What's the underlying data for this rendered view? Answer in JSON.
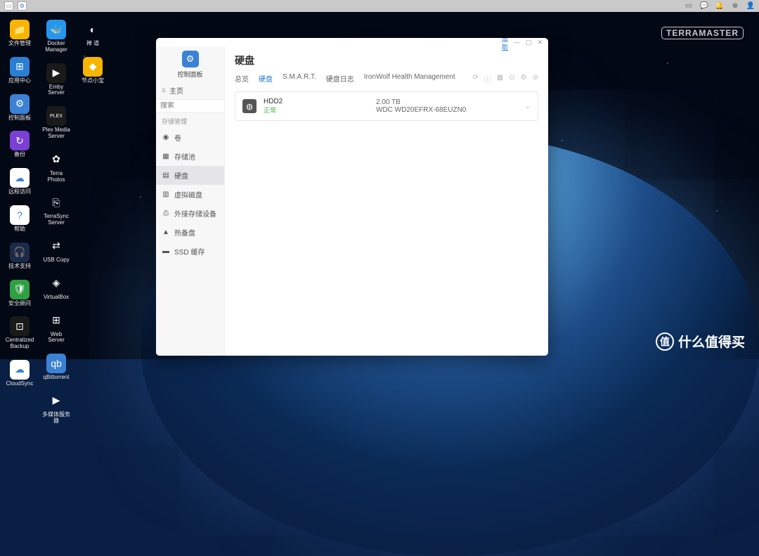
{
  "brand": "TERRAMASTER",
  "watermark": {
    "icon": "值",
    "text": "什么值得买"
  },
  "taskbar": {
    "left_apps": [
      "desktop",
      "control-panel"
    ],
    "right_icons": [
      "screen",
      "chat",
      "bell",
      "globe",
      "user"
    ]
  },
  "desktop_icons": {
    "col1": [
      {
        "name": "file-manager",
        "label": "文件管理",
        "bg": "#f7b500",
        "glyph": "📁"
      },
      {
        "name": "app-center",
        "label": "应用中心",
        "bg": "#2a7fd4",
        "glyph": "⊞"
      },
      {
        "name": "control-panel",
        "label": "控制面板",
        "bg": "#3b82d6",
        "glyph": "⚙"
      },
      {
        "name": "backup",
        "label": "备份",
        "bg": "#7b3fd4",
        "glyph": "↻"
      },
      {
        "name": "remote-access",
        "label": "远程访问",
        "bg": "#ffffff",
        "glyph": "☁"
      },
      {
        "name": "help",
        "label": "帮助",
        "bg": "#ffffff",
        "glyph": "?"
      },
      {
        "name": "tech-support",
        "label": "技术支持",
        "bg": "#1a2a4a",
        "glyph": "🎧"
      },
      {
        "name": "security-advisor",
        "label": "安全顾问",
        "bg": "#2ea043",
        "glyph": "🛡"
      },
      {
        "name": "centralized-backup",
        "label": "Centralized\nBackup",
        "bg": "#1a1a1a",
        "glyph": "⊡"
      },
      {
        "name": "cloudsync",
        "label": "CloudSync",
        "bg": "#ffffff",
        "glyph": "☁"
      }
    ],
    "col2": [
      {
        "name": "docker-manager",
        "label": "Docker\nManager",
        "bg": "#2496ed",
        "glyph": "🐳"
      },
      {
        "name": "emby-server",
        "label": "Emby Server",
        "bg": "#1a1a1a",
        "glyph": "▶"
      },
      {
        "name": "plex-media-server",
        "label": "Plex Media\nServer",
        "bg": "#1a1a1a",
        "glyph": "PLEX"
      },
      {
        "name": "terra-photos",
        "label": "Terra Photos",
        "bg": "transparent",
        "glyph": "✿"
      },
      {
        "name": "terrasync-server",
        "label": "TerraSync\nServer",
        "bg": "transparent",
        "glyph": "⎘"
      },
      {
        "name": "usb-copy",
        "label": "USB Copy",
        "bg": "transparent",
        "glyph": "⇄"
      },
      {
        "name": "virtualbox",
        "label": "VirtualBox",
        "bg": "transparent",
        "glyph": "◈"
      },
      {
        "name": "web-server",
        "label": "Web Server",
        "bg": "transparent",
        "glyph": "⊞"
      },
      {
        "name": "qbittorrent",
        "label": "qBittorrent",
        "bg": "#3b82d6",
        "glyph": "qb"
      },
      {
        "name": "media-server",
        "label": "多媒体服务器",
        "bg": "transparent",
        "glyph": "▶"
      }
    ],
    "col3": [
      {
        "name": "chan-dao",
        "label": "禅 道",
        "bg": "transparent",
        "glyph": "◐"
      },
      {
        "name": "node-xiaobao",
        "label": "节点小宝",
        "bg": "#f7b500",
        "glyph": "◆"
      }
    ]
  },
  "window": {
    "help_link": "帮助",
    "app_icon_name": "控制面板",
    "sidebar": {
      "home": "主页",
      "search_placeholder": "搜索",
      "group": "存储管理",
      "items": [
        {
          "id": "volume",
          "label": "卷",
          "glyph": "◉"
        },
        {
          "id": "pool",
          "label": "存储池",
          "glyph": "▦"
        },
        {
          "id": "disk",
          "label": "硬盘",
          "glyph": "▤",
          "active": true
        },
        {
          "id": "virtual-disk",
          "label": "虚拟磁盘",
          "glyph": "▥"
        },
        {
          "id": "external",
          "label": "外接存储设备",
          "glyph": "⎙"
        },
        {
          "id": "hot-spare",
          "label": "热备盘",
          "glyph": "▲"
        },
        {
          "id": "ssd-cache",
          "label": "SSD 缓存",
          "glyph": "▬"
        }
      ]
    },
    "main": {
      "title": "硬盘",
      "tabs": [
        {
          "id": "overview",
          "label": "总览"
        },
        {
          "id": "disk",
          "label": "硬盘",
          "active": true
        },
        {
          "id": "smart",
          "label": "S.M.A.R.T."
        },
        {
          "id": "disk-log",
          "label": "硬盘日志"
        },
        {
          "id": "ironwolf",
          "label": "IronWolf Health Management"
        }
      ],
      "disk": {
        "name": "HDD2",
        "status": "正常",
        "size": "2.00 TB",
        "model": "WDC WD20EFRX-68EUZN0"
      }
    }
  }
}
